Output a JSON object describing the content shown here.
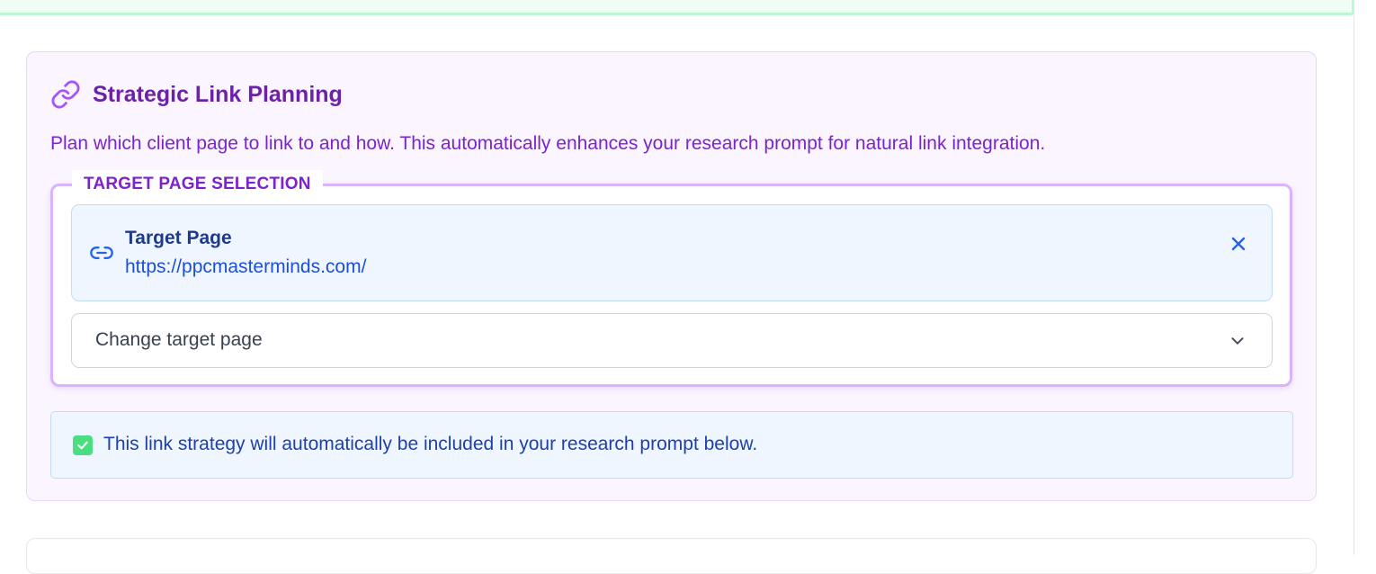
{
  "panel": {
    "title": "Strategic Link Planning",
    "description": "Plan which client page to link to and how. This automatically enhances your research prompt for natural link integration.",
    "icon": "link-icon",
    "accent_color": "#7e22ce"
  },
  "target_selection": {
    "legend": "TARGET PAGE SELECTION",
    "selected": {
      "label": "Target Page",
      "url": "https://ppcmasterminds.com/",
      "icon": "link-icon",
      "remove_icon": "close-icon"
    },
    "dropdown": {
      "value": "Change target page",
      "icon": "chevron-down-icon"
    }
  },
  "notice": {
    "icon": "checkmark-icon",
    "text": "This link strategy will automatically be included in your research prompt below."
  }
}
